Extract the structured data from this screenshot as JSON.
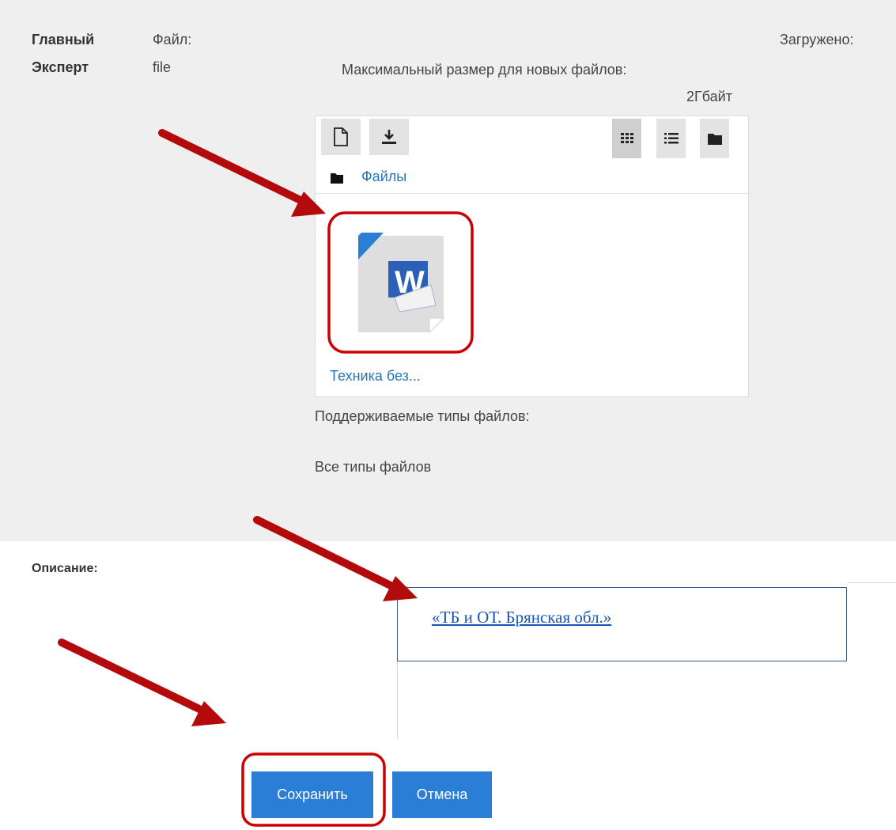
{
  "form": {
    "role_line1": "Главный",
    "role_line2": "Эксперт",
    "file_label_line1": "Файл:",
    "file_label_line2": "file",
    "uploaded_label": "Загружено:",
    "max_size_line1": "Максимальный размер для новых файлов:",
    "max_size_line2": "2Гбайт",
    "supported_types_label": "Поддерживаемые типы файлов:",
    "supported_types_value": "Все типы файлов",
    "description_label": "Описание:",
    "description_link": "«ТБ и ОТ. Брянская обл.»"
  },
  "filemanager": {
    "breadcrumb": "Файлы",
    "file_name": "Техника без...",
    "toolbar_icons": [
      "file-icon",
      "download-icon"
    ],
    "view_icons": [
      "grid-view-icon",
      "list-view-icon",
      "folder-view-icon"
    ],
    "file_icon": "word-document-icon"
  },
  "buttons": {
    "save": "Сохранить",
    "cancel": "Отмена"
  },
  "colors": {
    "accent": "#2b7ed6",
    "link": "#2275b9",
    "annotation": "#b30b0b"
  }
}
